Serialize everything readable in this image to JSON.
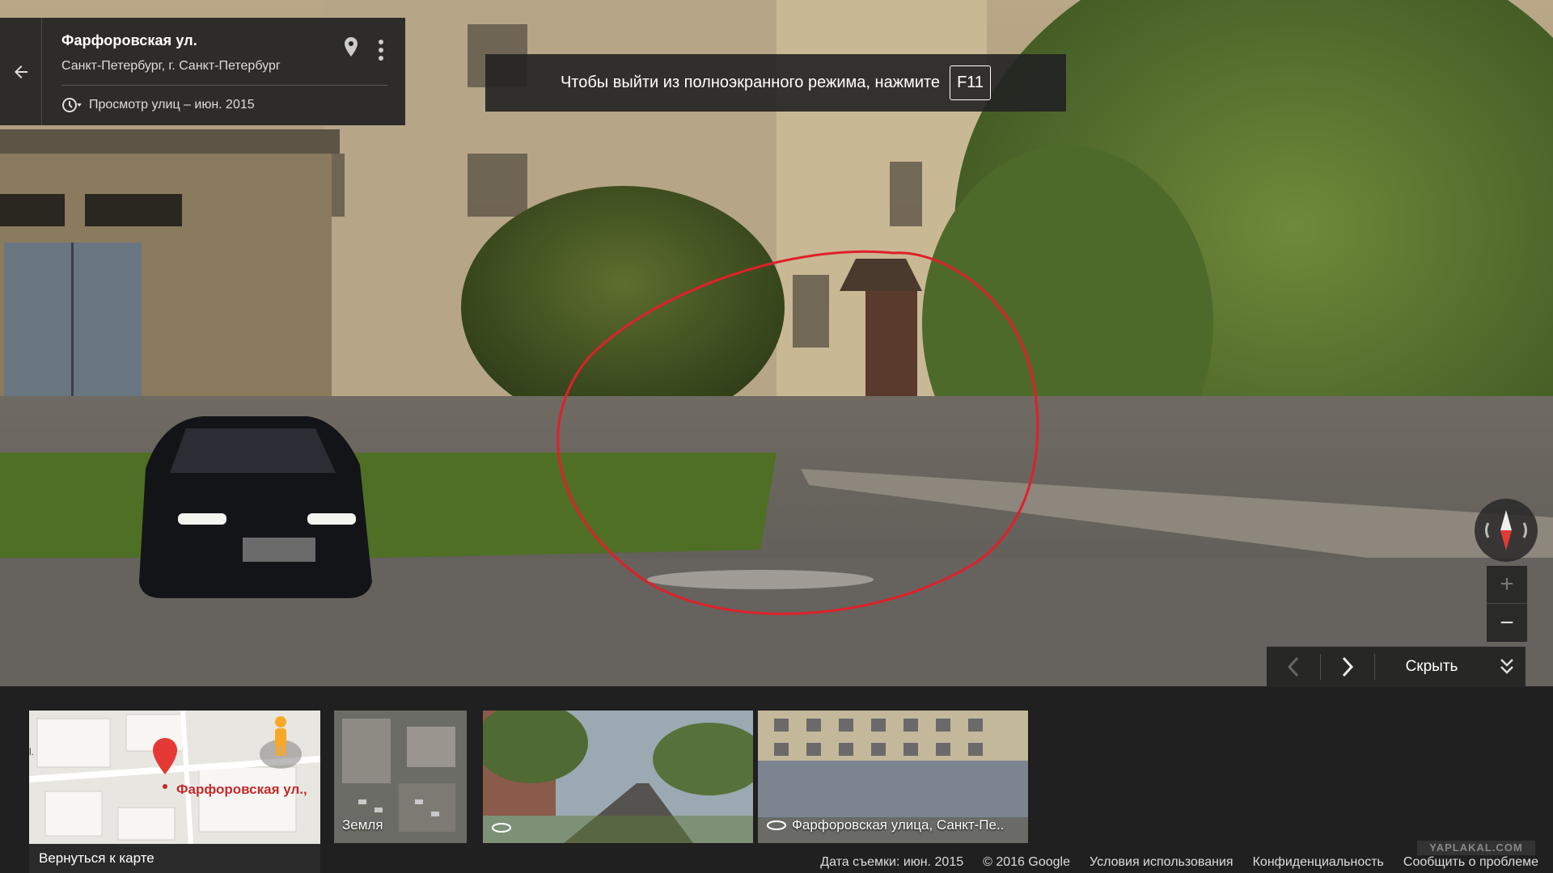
{
  "location": {
    "title": "Фарфоровская ул.",
    "subtitle": "Санкт-Петербург, г. Санкт-Петербург",
    "capture": "Просмотр улиц – июн. 2015"
  },
  "fullscreen_hint": {
    "text": "Чтобы выйти из полноэкранного режима, нажмите",
    "key": "F11"
  },
  "controls": {
    "hide_label": "Скрыть",
    "zoom_in": "+",
    "zoom_out": "−"
  },
  "filmstrip": {
    "map_label": "Фарфоровская ул.,",
    "map_prefix": "l.",
    "back_to_map": "Вернуться к карте",
    "earth_label": "Земля",
    "photo_caption": "Фарфоровская улица, Санкт-Пе.."
  },
  "footer": {
    "date": "Дата съемки: июн. 2015",
    "copyright": "© 2016 Google",
    "terms": "Условия использования",
    "privacy": "Конфиденциальность",
    "report": "Сообщить о проблеме"
  },
  "watermark": "YAPLAKAL.COM",
  "colors": {
    "annotation_red": "#e0202a",
    "marker_red": "#e53935"
  }
}
